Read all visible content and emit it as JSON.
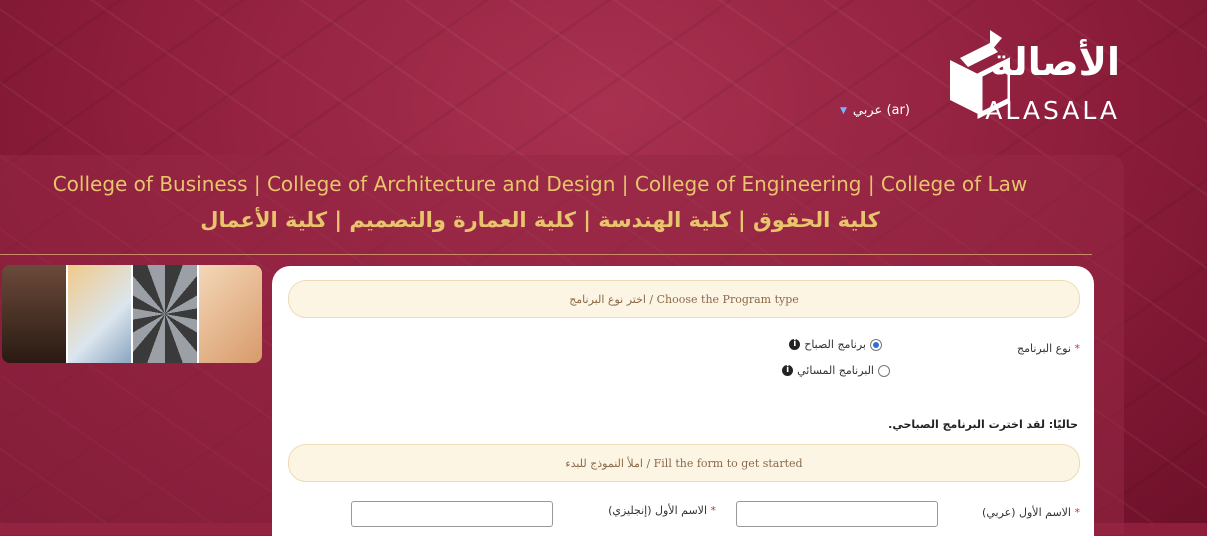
{
  "header": {
    "logo_ar": "الأصالة",
    "logo_en": "ALASALA",
    "language_selector": "عربي (ar)"
  },
  "banner": {
    "colleges_en": "College of Business | College of Architecture and Design | College of Engineering | College of Law",
    "colleges_ar": "كلية الحقوق | كلية الهندسة | كلية العمارة والتصميم | كلية الأعمال"
  },
  "form": {
    "program_section_title": "اختر نوع البرنامج / Choose the Program type",
    "program_type_label": "نوع البرنامج",
    "required_mark": "*",
    "options": [
      {
        "label": "برنامج الصباح",
        "selected": true
      },
      {
        "label": "البرنامج المسائي",
        "selected": false
      }
    ],
    "current_selection": ".حاليًا: لقد اخترت البرنامج الصباحي",
    "fill_section_title": "املأ النموذج للبدء / Fill the form to get started",
    "first_name_ar_label": "الاسم الأول (عربي)",
    "first_name_en_label": "الاسم الأول (إنجليزي)"
  },
  "colors": {
    "accent_gold": "#e8c46c",
    "radio_blue": "#2d6de0",
    "required_red": "#c0392b"
  }
}
